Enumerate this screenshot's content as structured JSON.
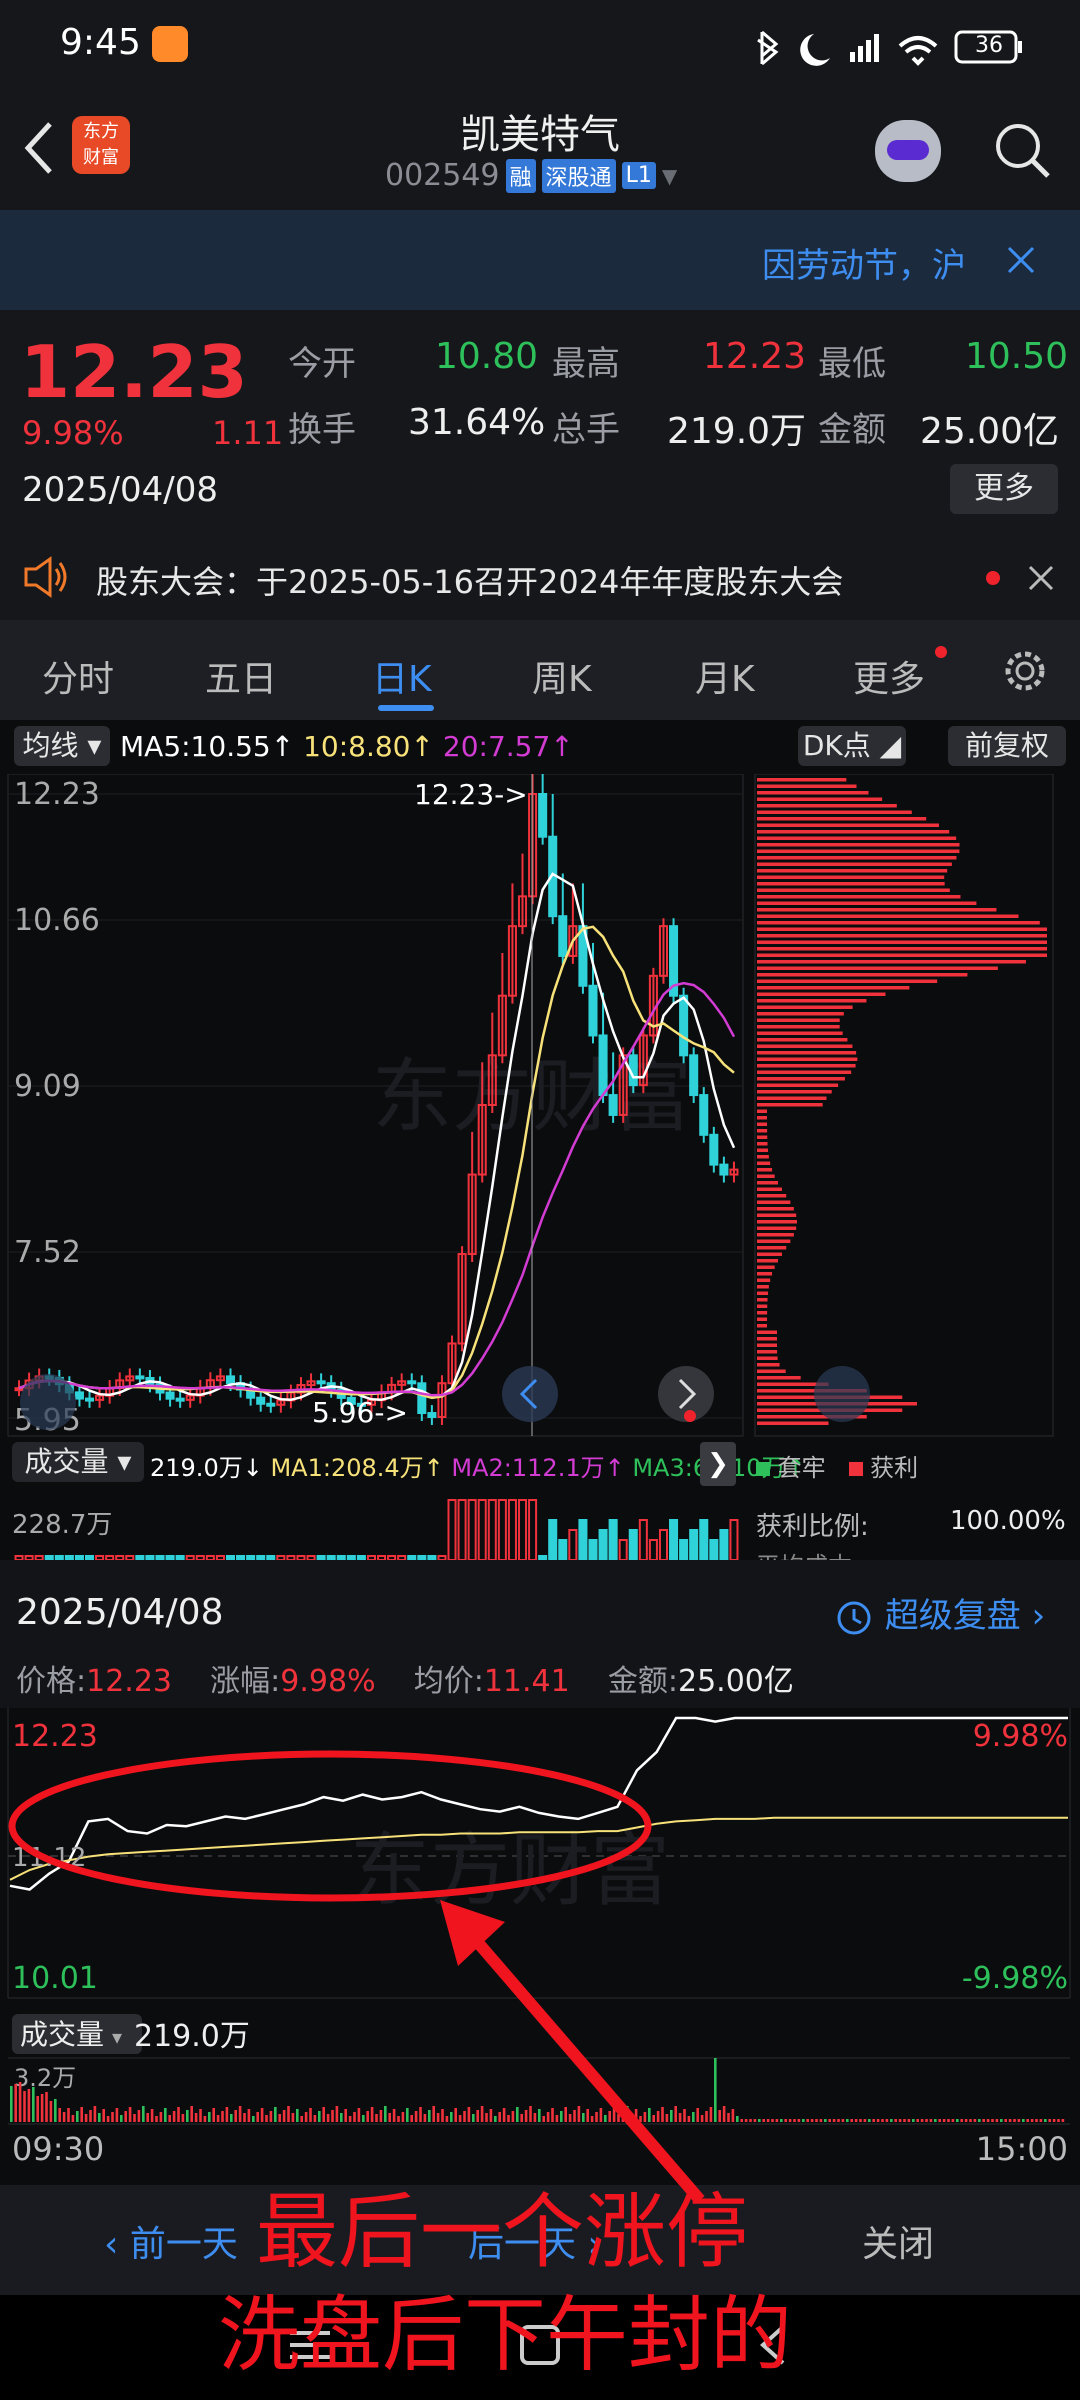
{
  "status": {
    "time": "9:45",
    "battery": "36"
  },
  "header": {
    "title": "凯美特气",
    "code": "002549",
    "tag_margin": "融",
    "tag_connect": "深股通",
    "tag_level": "L1",
    "logo_line1": "东方",
    "logo_line2": "财富"
  },
  "banner": {
    "text": "因劳动节，沪"
  },
  "quote": {
    "price": "12.23",
    "pct": "9.98%",
    "change": "1.11",
    "date": "2025/04/08",
    "open_label": "今开",
    "open": "10.80",
    "high_label": "最高",
    "high": "12.23",
    "low_label": "最低",
    "low": "10.50",
    "turnover_label": "换手",
    "turnover": "31.64%",
    "volume_label": "总手",
    "volume": "219.0万",
    "amount_label": "金额",
    "amount": "25.00亿",
    "more": "更多"
  },
  "notice": {
    "text": "股东大会：于2025-05-16召开2024年年度股东大会"
  },
  "tabs": [
    {
      "label": "分时"
    },
    {
      "label": "五日"
    },
    {
      "label": "日K"
    },
    {
      "label": "周K"
    },
    {
      "label": "月K"
    },
    {
      "label": "更多"
    }
  ],
  "kline": {
    "ma_selector": "均线",
    "ma5": "MA5:10.55",
    "ma10": "10:8.80",
    "ma20": "20:7.57",
    "arrow": "↑",
    "dk": "DK点",
    "adjust": "前复权",
    "y_labels": [
      "12.23",
      "10.66",
      "9.09",
      "7.52",
      "5.95"
    ],
    "max_annot": "12.23->",
    "min_annot": "5.96->",
    "watermark": "东方财富",
    "vol_selector": "成交量",
    "vol_value": "219.0万",
    "vol_ma1": "MA1:208.4万",
    "vol_ma2": "MA2:112.1万",
    "vol_ma3": "MA3:60.10万",
    "vol_top": "228.7万",
    "chip_legend_trapped": "套牢",
    "chip_legend_profit": "获利",
    "chip_profit_ratio_label": "获利比例:",
    "chip_profit_ratio": "100.00%",
    "chip_avg_label": "平均成本"
  },
  "colors": {
    "up": "#f0323c",
    "down": "#2fd2d8",
    "ma5": "#ffffff",
    "ma10": "#f7e27a",
    "ma20": "#d23cd2",
    "accent": "#3d8ef0",
    "green": "#2ec05a"
  },
  "chart_data": {
    "type": "line",
    "title": "",
    "date": "2025/04/08",
    "price_label": "价格:",
    "price": "12.23",
    "pct_label": "涨幅:",
    "pct": "9.98%",
    "avg_label": "均价:",
    "avg": "11.41",
    "amount_label": "金额:",
    "amount": "25.00亿",
    "replay": "超级复盘",
    "y_max_label": "12.23",
    "y_mid_label": "11.12",
    "y_min_label": "10.01",
    "pct_max_label": "9.98%",
    "pct_min_label": "-9.98%",
    "x_start": "09:30",
    "x_end": "15:00",
    "vol_label": "成交量",
    "vol_value": "219.0万",
    "vol_top": "3.2万",
    "ylim": [
      10.01,
      12.23
    ],
    "series": [
      {
        "values": [
          10.85,
          10.82,
          10.95,
          11.05,
          11.38,
          11.4,
          11.3,
          11.28,
          11.35,
          11.34,
          11.38,
          11.42,
          11.4,
          11.44,
          11.48,
          11.52,
          11.58,
          11.55,
          11.6,
          11.56,
          11.58,
          11.62,
          11.56,
          11.52,
          11.48,
          11.46,
          11.5,
          11.45,
          11.42,
          11.4,
          11.45,
          11.5,
          11.8,
          11.95,
          12.23,
          12.23,
          12.2,
          12.23,
          12.23,
          12.23,
          12.23,
          12.23,
          12.23,
          12.23,
          12.23,
          12.23,
          12.23,
          12.23,
          12.23,
          12.23,
          12.23,
          12.23,
          12.23,
          12.23,
          12.23
        ]
      },
      {
        "values": [
          10.9,
          10.98,
          11.03,
          11.06,
          11.09,
          11.11,
          11.12,
          11.13,
          11.14,
          11.15,
          11.16,
          11.17,
          11.18,
          11.19,
          11.2,
          11.21,
          11.22,
          11.23,
          11.24,
          11.25,
          11.26,
          11.27,
          11.27,
          11.28,
          11.28,
          11.28,
          11.29,
          11.29,
          11.29,
          11.29,
          11.3,
          11.3,
          11.33,
          11.36,
          11.38,
          11.39,
          11.4,
          11.4,
          11.4,
          11.41,
          11.41,
          11.41,
          11.41,
          11.41,
          11.41,
          11.41,
          11.41,
          11.41,
          11.41,
          11.41,
          11.41,
          11.41,
          11.41,
          11.41,
          11.41
        ]
      }
    ]
  },
  "bottom": {
    "prev": "前一天",
    "next": "后一天",
    "close": "关闭"
  },
  "annotation": {
    "line1": "最后一个涨停",
    "line2": "洗盘后下午封的"
  }
}
